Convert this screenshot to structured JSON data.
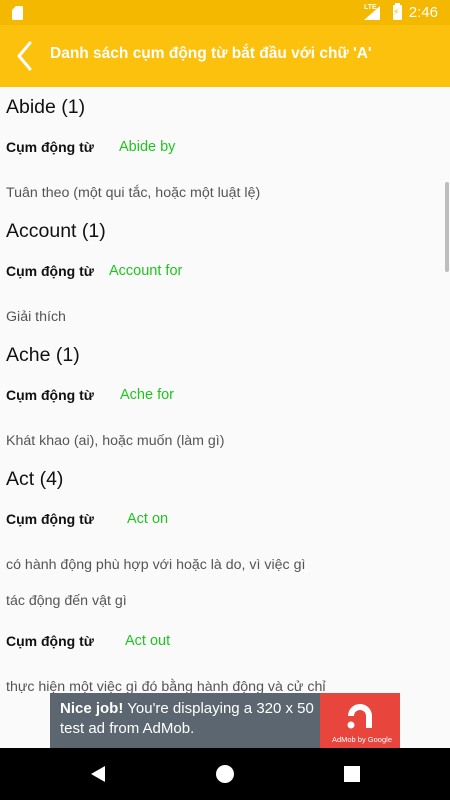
{
  "status_bar": {
    "time": "2:46",
    "network": "LTE"
  },
  "app_bar": {
    "title": "Danh sách cụm động từ bắt đầu với chữ 'A'"
  },
  "groups": [
    {
      "title": "Abide (1)",
      "entries": [
        {
          "label": "Cụm động từ",
          "phrase": "Abide by",
          "meanings": [
            "Tuân theo (một qui tắc, hoặc một luật lệ)"
          ]
        }
      ]
    },
    {
      "title": "Account (1)",
      "entries": [
        {
          "label": "Cụm động từ",
          "phrase": "Account for",
          "meanings": [
            "Giải thích"
          ]
        }
      ]
    },
    {
      "title": "Ache (1)",
      "entries": [
        {
          "label": "Cụm động từ",
          "phrase": "Ache for",
          "meanings": [
            "Khát khao (ai), hoặc muốn (làm gì)"
          ]
        }
      ]
    },
    {
      "title": "Act (4)",
      "entries": [
        {
          "label": "Cụm động từ",
          "phrase": "Act on",
          "meanings": [
            "có hành động phù hợp với hoặc là do, vì việc gì",
            "tác động đến vật gì"
          ]
        },
        {
          "label": "Cụm động từ",
          "phrase": "Act out",
          "meanings": [
            "thực hiện một việc gì đó bằng hành động và cử chỉ"
          ]
        }
      ]
    }
  ],
  "ad": {
    "headline": "Nice job!",
    "body": "You're displaying a 320 x 50 test ad from AdMob.",
    "caption": "AdMob by Google",
    "logo_icon": "admob-logo"
  },
  "nav_bar": {
    "icons": [
      "back-triangle-icon",
      "home-circle-icon",
      "recents-square-icon"
    ]
  },
  "colors": {
    "accent": "#fbc10c",
    "phrase": "#1fc51f",
    "ad_bg": "#5c6671",
    "ad_logo_bg": "#e8453c"
  }
}
